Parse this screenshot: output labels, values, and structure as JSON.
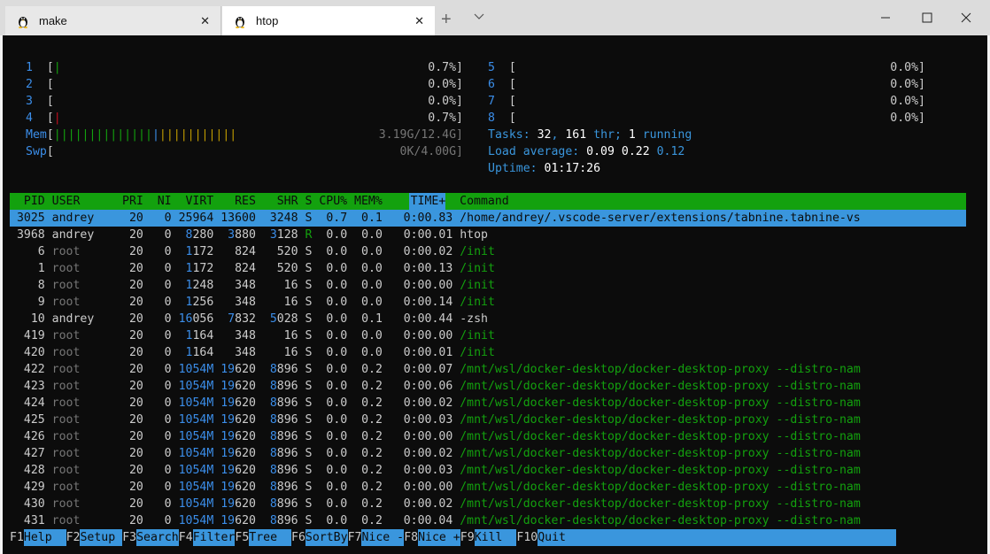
{
  "tabs": [
    {
      "label": "make"
    },
    {
      "label": "htop"
    }
  ],
  "window": {
    "minimize": "—",
    "maximize": "☐",
    "close": "✕"
  },
  "cpus_left": [
    {
      "num": "1",
      "bar": "|",
      "bar_color": "green",
      "pct": "0.7%]"
    },
    {
      "num": "2",
      "bar": "",
      "bar_color": "green",
      "pct": "0.0%]"
    },
    {
      "num": "3",
      "bar": "",
      "bar_color": "green",
      "pct": "0.0%]"
    },
    {
      "num": "4",
      "bar": "|",
      "bar_color": "red",
      "pct": "0.7%]"
    }
  ],
  "cpus_right": [
    {
      "num": "5",
      "pct": "0.0%]"
    },
    {
      "num": "6",
      "pct": "0.0%]"
    },
    {
      "num": "7",
      "pct": "0.0%]"
    },
    {
      "num": "8",
      "pct": "0.0%]"
    }
  ],
  "mem": {
    "label": "Mem",
    "bar_green": "||||||||||||||",
    "bar_blue": "|",
    "bar_yellow": "|||||||||||",
    "value": "3.19G/12.4G]"
  },
  "swp": {
    "label": "Swp",
    "value": "0K/4.00G]"
  },
  "tasks": {
    "label": "Tasks: ",
    "count": "32",
    "sep": ", ",
    "thr": "161",
    "thr_label": " thr; ",
    "running": "1",
    "running_label": " running"
  },
  "load": {
    "label": "Load average: ",
    "l1": "0.09",
    "l5": "0.22",
    "l15": "0.12"
  },
  "uptime": {
    "label": "Uptime: ",
    "value": "01:17:26"
  },
  "header": "  PID USER      PRI  NI  VIRT   RES   SHR S ",
  "header_cpu": "CPU%",
  "header_rest": " MEM%    TIME+  Command",
  "processes": [
    {
      "pid": "3025",
      "user": "andrey",
      "pri": "20",
      "ni": "0",
      "virt": "25964",
      "res": "13600",
      "shr": "3248",
      "s": "S",
      "cpu": "0.7",
      "mem": "0.1",
      "time": "0:00.83",
      "cmd": "/home/andrey/.vscode-server/extensions/tabnine.tabnine-vs"
    },
    {
      "pid": "3968",
      "user": "andrey",
      "pri": "20",
      "ni": "0",
      "virt": "8280",
      "res": "3880",
      "shr": "3128",
      "s": "R",
      "cpu": "0.0",
      "mem": "0.0",
      "time": "0:00.01",
      "cmd": "htop"
    },
    {
      "pid": "6",
      "user": "root",
      "pri": "20",
      "ni": "0",
      "virt": "1172",
      "res": "824",
      "shr": "520",
      "s": "S",
      "cpu": "0.0",
      "mem": "0.0",
      "time": "0:00.02",
      "cmd": "/init"
    },
    {
      "pid": "1",
      "user": "root",
      "pri": "20",
      "ni": "0",
      "virt": "1172",
      "res": "824",
      "shr": "520",
      "s": "S",
      "cpu": "0.0",
      "mem": "0.0",
      "time": "0:00.13",
      "cmd": "/init"
    },
    {
      "pid": "8",
      "user": "root",
      "pri": "20",
      "ni": "0",
      "virt": "1248",
      "res": "348",
      "shr": "16",
      "s": "S",
      "cpu": "0.0",
      "mem": "0.0",
      "time": "0:00.00",
      "cmd": "/init"
    },
    {
      "pid": "9",
      "user": "root",
      "pri": "20",
      "ni": "0",
      "virt": "1256",
      "res": "348",
      "shr": "16",
      "s": "S",
      "cpu": "0.0",
      "mem": "0.0",
      "time": "0:00.14",
      "cmd": "/init"
    },
    {
      "pid": "10",
      "user": "andrey",
      "pri": "20",
      "ni": "0",
      "virt": "16056",
      "res": "7832",
      "shr": "5028",
      "s": "S",
      "cpu": "0.0",
      "mem": "0.1",
      "time": "0:00.44",
      "cmd": "-zsh"
    },
    {
      "pid": "419",
      "user": "root",
      "pri": "20",
      "ni": "0",
      "virt": "1164",
      "res": "348",
      "shr": "16",
      "s": "S",
      "cpu": "0.0",
      "mem": "0.0",
      "time": "0:00.00",
      "cmd": "/init"
    },
    {
      "pid": "420",
      "user": "root",
      "pri": "20",
      "ni": "0",
      "virt": "1164",
      "res": "348",
      "shr": "16",
      "s": "S",
      "cpu": "0.0",
      "mem": "0.0",
      "time": "0:00.01",
      "cmd": "/init"
    },
    {
      "pid": "422",
      "user": "root",
      "pri": "20",
      "ni": "0",
      "virt": "1054M",
      "res": "19620",
      "shr": "8896",
      "s": "S",
      "cpu": "0.0",
      "mem": "0.2",
      "time": "0:00.07",
      "cmd": "/mnt/wsl/docker-desktop/docker-desktop-proxy --distro-nam"
    },
    {
      "pid": "423",
      "user": "root",
      "pri": "20",
      "ni": "0",
      "virt": "1054M",
      "res": "19620",
      "shr": "8896",
      "s": "S",
      "cpu": "0.0",
      "mem": "0.2",
      "time": "0:00.06",
      "cmd": "/mnt/wsl/docker-desktop/docker-desktop-proxy --distro-nam"
    },
    {
      "pid": "424",
      "user": "root",
      "pri": "20",
      "ni": "0",
      "virt": "1054M",
      "res": "19620",
      "shr": "8896",
      "s": "S",
      "cpu": "0.0",
      "mem": "0.2",
      "time": "0:00.02",
      "cmd": "/mnt/wsl/docker-desktop/docker-desktop-proxy --distro-nam"
    },
    {
      "pid": "425",
      "user": "root",
      "pri": "20",
      "ni": "0",
      "virt": "1054M",
      "res": "19620",
      "shr": "8896",
      "s": "S",
      "cpu": "0.0",
      "mem": "0.2",
      "time": "0:00.03",
      "cmd": "/mnt/wsl/docker-desktop/docker-desktop-proxy --distro-nam"
    },
    {
      "pid": "426",
      "user": "root",
      "pri": "20",
      "ni": "0",
      "virt": "1054M",
      "res": "19620",
      "shr": "8896",
      "s": "S",
      "cpu": "0.0",
      "mem": "0.2",
      "time": "0:00.00",
      "cmd": "/mnt/wsl/docker-desktop/docker-desktop-proxy --distro-nam"
    },
    {
      "pid": "427",
      "user": "root",
      "pri": "20",
      "ni": "0",
      "virt": "1054M",
      "res": "19620",
      "shr": "8896",
      "s": "S",
      "cpu": "0.0",
      "mem": "0.2",
      "time": "0:00.02",
      "cmd": "/mnt/wsl/docker-desktop/docker-desktop-proxy --distro-nam"
    },
    {
      "pid": "428",
      "user": "root",
      "pri": "20",
      "ni": "0",
      "virt": "1054M",
      "res": "19620",
      "shr": "8896",
      "s": "S",
      "cpu": "0.0",
      "mem": "0.2",
      "time": "0:00.03",
      "cmd": "/mnt/wsl/docker-desktop/docker-desktop-proxy --distro-nam"
    },
    {
      "pid": "429",
      "user": "root",
      "pri": "20",
      "ni": "0",
      "virt": "1054M",
      "res": "19620",
      "shr": "8896",
      "s": "S",
      "cpu": "0.0",
      "mem": "0.2",
      "time": "0:00.00",
      "cmd": "/mnt/wsl/docker-desktop/docker-desktop-proxy --distro-nam"
    },
    {
      "pid": "430",
      "user": "root",
      "pri": "20",
      "ni": "0",
      "virt": "1054M",
      "res": "19620",
      "shr": "8896",
      "s": "S",
      "cpu": "0.0",
      "mem": "0.2",
      "time": "0:00.02",
      "cmd": "/mnt/wsl/docker-desktop/docker-desktop-proxy --distro-nam"
    },
    {
      "pid": "431",
      "user": "root",
      "pri": "20",
      "ni": "0",
      "virt": "1054M",
      "res": "19620",
      "shr": "8896",
      "s": "S",
      "cpu": "0.0",
      "mem": "0.2",
      "time": "0:00.04",
      "cmd": "/mnt/wsl/docker-desktop/docker-desktop-proxy --distro-nam"
    }
  ],
  "fkeys": [
    {
      "key": "F1",
      "label": "Help  "
    },
    {
      "key": "F2",
      "label": "Setup "
    },
    {
      "key": "F3",
      "label": "Search"
    },
    {
      "key": "F4",
      "label": "Filter"
    },
    {
      "key": "F5",
      "label": "Tree  "
    },
    {
      "key": "F6",
      "label": "SortBy"
    },
    {
      "key": "F7",
      "label": "Nice -"
    },
    {
      "key": "F8",
      "label": "Nice +"
    },
    {
      "key": "F9",
      "label": "Kill  "
    },
    {
      "key": "F10",
      "label": "Quit"
    }
  ],
  "colors": {
    "terminal_bg": "#0c0c0c",
    "green": "#13a10e",
    "blue": "#3a96dd",
    "red": "#c50f1f",
    "yellow": "#c19c00"
  }
}
